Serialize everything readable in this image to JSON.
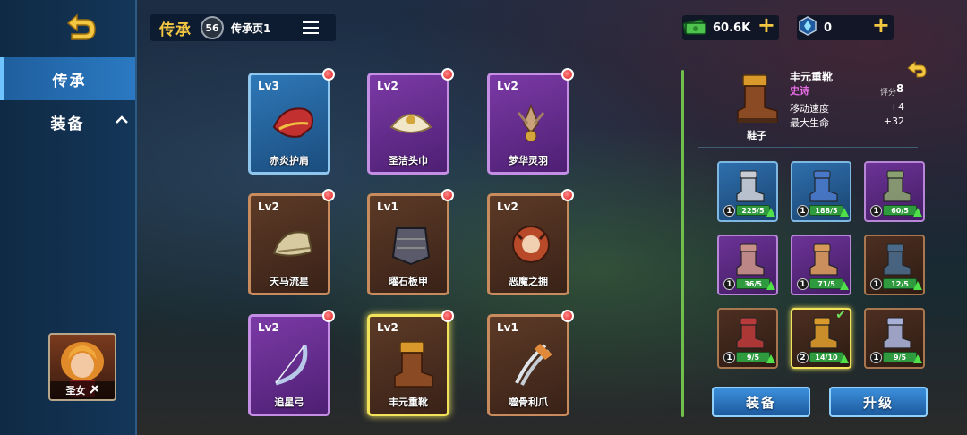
{
  "sidebar": {
    "tabs": [
      {
        "label": "传承"
      },
      {
        "label": "装备"
      }
    ],
    "hero_name": "圣女"
  },
  "topbar": {
    "title": "传承",
    "level": "56",
    "page": "传承页1"
  },
  "currency": {
    "cash": "60.6K",
    "gem": "0"
  },
  "legacy_cards": [
    {
      "lv": "Lv3",
      "name": "赤炎护肩",
      "rarity": "blue"
    },
    {
      "lv": "Lv2",
      "name": "圣洁头巾",
      "rarity": "purple"
    },
    {
      "lv": "Lv2",
      "name": "梦华灵羽",
      "rarity": "purple"
    },
    {
      "lv": "Lv2",
      "name": "天马流星",
      "rarity": "brown"
    },
    {
      "lv": "Lv1",
      "name": "曜石板甲",
      "rarity": "brown"
    },
    {
      "lv": "Lv2",
      "name": "恶魔之拥",
      "rarity": "brown"
    },
    {
      "lv": "Lv2",
      "name": "追星弓",
      "rarity": "purple"
    },
    {
      "lv": "Lv2",
      "name": "丰元重靴",
      "rarity": "brown"
    },
    {
      "lv": "Lv1",
      "name": "噬骨利爪",
      "rarity": "brown"
    }
  ],
  "detail": {
    "name": "丰元重靴",
    "rarity": "史诗",
    "category": "鞋子",
    "score_label": "评分",
    "score": "8",
    "stats": [
      {
        "label": "移动速度",
        "value": "+4"
      },
      {
        "label": "最大生命",
        "value": "+32"
      }
    ]
  },
  "slots": [
    {
      "count": "1",
      "progress": "225/5",
      "rarity": "blue"
    },
    {
      "count": "1",
      "progress": "188/5",
      "rarity": "blue"
    },
    {
      "count": "1",
      "progress": "60/5",
      "rarity": "purple"
    },
    {
      "count": "1",
      "progress": "36/5",
      "rarity": "purple"
    },
    {
      "count": "1",
      "progress": "71/5",
      "rarity": "purple"
    },
    {
      "count": "1",
      "progress": "12/5",
      "rarity": "brown"
    },
    {
      "count": "1",
      "progress": "9/5",
      "rarity": "brown"
    },
    {
      "count": "2",
      "progress": "14/10",
      "rarity": "brown"
    },
    {
      "count": "1",
      "progress": "9/5",
      "rarity": "brown"
    }
  ],
  "buttons": {
    "equip": "装备",
    "upgrade": "升级"
  },
  "colors": {
    "accent_gold": "#f4c743",
    "accent_blue": "#3c8fdb",
    "rarity_epic": "#e76be4",
    "selection": "#f2e35a"
  }
}
